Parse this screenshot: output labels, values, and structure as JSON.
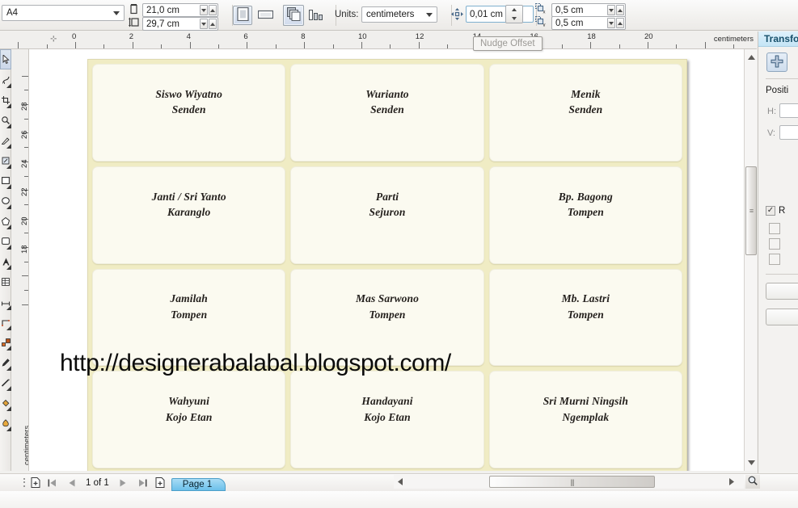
{
  "app": {
    "name": "CorelDRAW"
  },
  "propbar": {
    "page_size": "A4",
    "page_width": "21,0 cm",
    "page_height": "29,7 cm",
    "orientation": {
      "portrait": "portrait-icon",
      "landscape": "landscape-icon"
    },
    "apply_scope": {
      "all_pages": "all-pages-icon",
      "current_page": "current-page-icon"
    },
    "units_label": "Units:",
    "units_value": "centimeters",
    "nudge_offset": "0,01 cm",
    "duplicate_x": "0,5 cm",
    "duplicate_y": "0,5 cm"
  },
  "tooltip": {
    "text": "Nudge Offset"
  },
  "rulers": {
    "unit_caption": "centimeters",
    "horizontal_ticks": [
      "0",
      "2",
      "4",
      "6",
      "8",
      "10",
      "12",
      "14",
      "16",
      "18",
      "20"
    ],
    "vertical_ticks": [
      "28",
      "26",
      "24",
      "22",
      "20",
      "18"
    ]
  },
  "toolbox": {
    "tools": [
      "pick-tool-icon",
      "shape-tool-icon",
      "crop-tool-icon",
      "zoom-tool-icon",
      "freehand-tool-icon",
      "smart-fill-icon",
      "rectangle-tool-icon",
      "ellipse-tool-icon",
      "polygon-tool-icon",
      "basic-shapes-icon",
      "text-tool-icon",
      "table-tool-icon",
      "dimension-tool-icon",
      "connector-tool-icon",
      "blend-tool-icon",
      "color-eyedropper-icon",
      "outline-tool-icon",
      "fill-tool-icon",
      "interactive-fill-icon"
    ]
  },
  "document": {
    "watermark": "http://designerabalabal.blogspot.com/",
    "page_bg_color": "#f0ecc4",
    "card_bg_color": "#fbfaf0",
    "labels": [
      {
        "name": "Siswo Wiyatno",
        "place": "Senden"
      },
      {
        "name": "Wurianto",
        "place": "Senden"
      },
      {
        "name": "Menik",
        "place": "Senden"
      },
      {
        "name": "Janti / Sri Yanto",
        "place": "Karanglo"
      },
      {
        "name": "Parti",
        "place": "Sejuron"
      },
      {
        "name": "Bp. Bagong",
        "place": "Tompen"
      },
      {
        "name": "Jamilah",
        "place": "Tompen"
      },
      {
        "name": "Mas Sarwono",
        "place": "Tompen"
      },
      {
        "name": "Mb. Lastri",
        "place": "Tompen"
      },
      {
        "name": "Wahyuni",
        "place": "Kojo Etan"
      },
      {
        "name": "Handayani",
        "place": "Kojo Etan"
      },
      {
        "name": "Sri Murni Ningsih",
        "place": "Ngemplak"
      }
    ]
  },
  "statusbar": {
    "add_page_start": "add-page-icon",
    "first_page": "first-page-icon",
    "prev_page": "prev-page-icon",
    "page_count": "1 of 1",
    "next_page": "next-page-icon",
    "last_page": "last-page-icon",
    "add_page_end": "add-page-icon",
    "page_tab": "Page 1",
    "zoom_icon": "zoom-magnifier-icon"
  },
  "docker": {
    "title": "Transfo",
    "move_icon": "transform-position-icon",
    "section": "Positi",
    "h_label": "H:",
    "v_label": "V:",
    "relative_label": "R",
    "relative_checked": true,
    "accent_color": "#6cc0ea"
  }
}
